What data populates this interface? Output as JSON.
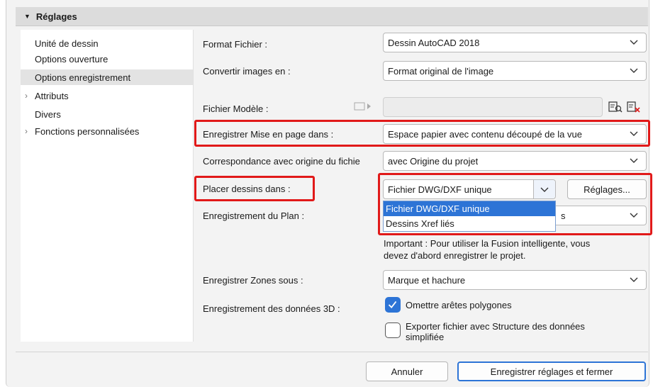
{
  "section": {
    "title": "Réglages"
  },
  "sidebar": {
    "items": [
      {
        "label": "Unité de dessin",
        "expandable": false,
        "selected": false
      },
      {
        "label": "Options ouverture",
        "expandable": false,
        "selected": false
      },
      {
        "label": "Options enregistrement",
        "expandable": false,
        "selected": true
      },
      {
        "label": "Attributs",
        "expandable": true,
        "selected": false
      },
      {
        "label": "Divers",
        "expandable": false,
        "selected": false
      },
      {
        "label": "Fonctions personnalisées",
        "expandable": true,
        "selected": false
      }
    ]
  },
  "form": {
    "format_fichier": {
      "label": "Format Fichier :",
      "value": "Dessin AutoCAD 2018"
    },
    "convertir_images": {
      "label": "Convertir images en :",
      "value": "Format original de l'image"
    },
    "fichier_modele": {
      "label": "Fichier Modèle :",
      "value": ""
    },
    "mise_en_page": {
      "label": "Enregistrer Mise en page dans :",
      "value": "Espace papier avec contenu découpé de la vue"
    },
    "correspondance": {
      "label": "Correspondance avec origine du fichie",
      "value": "avec Origine du projet"
    },
    "placer_dessins": {
      "label": "Placer dessins dans :",
      "value": "Fichier DWG/DXF unique",
      "settings_button": "Réglages...",
      "options": [
        "Fichier DWG/DXF unique",
        "Dessins Xref liés"
      ],
      "hidden_suffix": "s"
    },
    "enregistrement_plan": {
      "label": "Enregistrement du Plan :",
      "note": [
        "Important : Pour utiliser la Fusion intelligente, vous",
        "devez d'abord enregistrer le projet."
      ]
    },
    "zones": {
      "label": "Enregistrer Zones sous :",
      "value": "Marque et hachure"
    },
    "donnees_3d": {
      "label": "Enregistrement des données 3D :",
      "checkbox1": {
        "label": "Omettre arêtes polygones",
        "checked": true
      },
      "checkbox2": {
        "label_line1": "Exporter fichier avec Structure des données",
        "label_line2": "simplifiée",
        "checked": false
      }
    }
  },
  "footer": {
    "cancel": "Annuler",
    "save": "Enregistrer réglages et fermer"
  },
  "colors": {
    "accent": "#2d74d6",
    "highlight_red": "#e11919"
  }
}
